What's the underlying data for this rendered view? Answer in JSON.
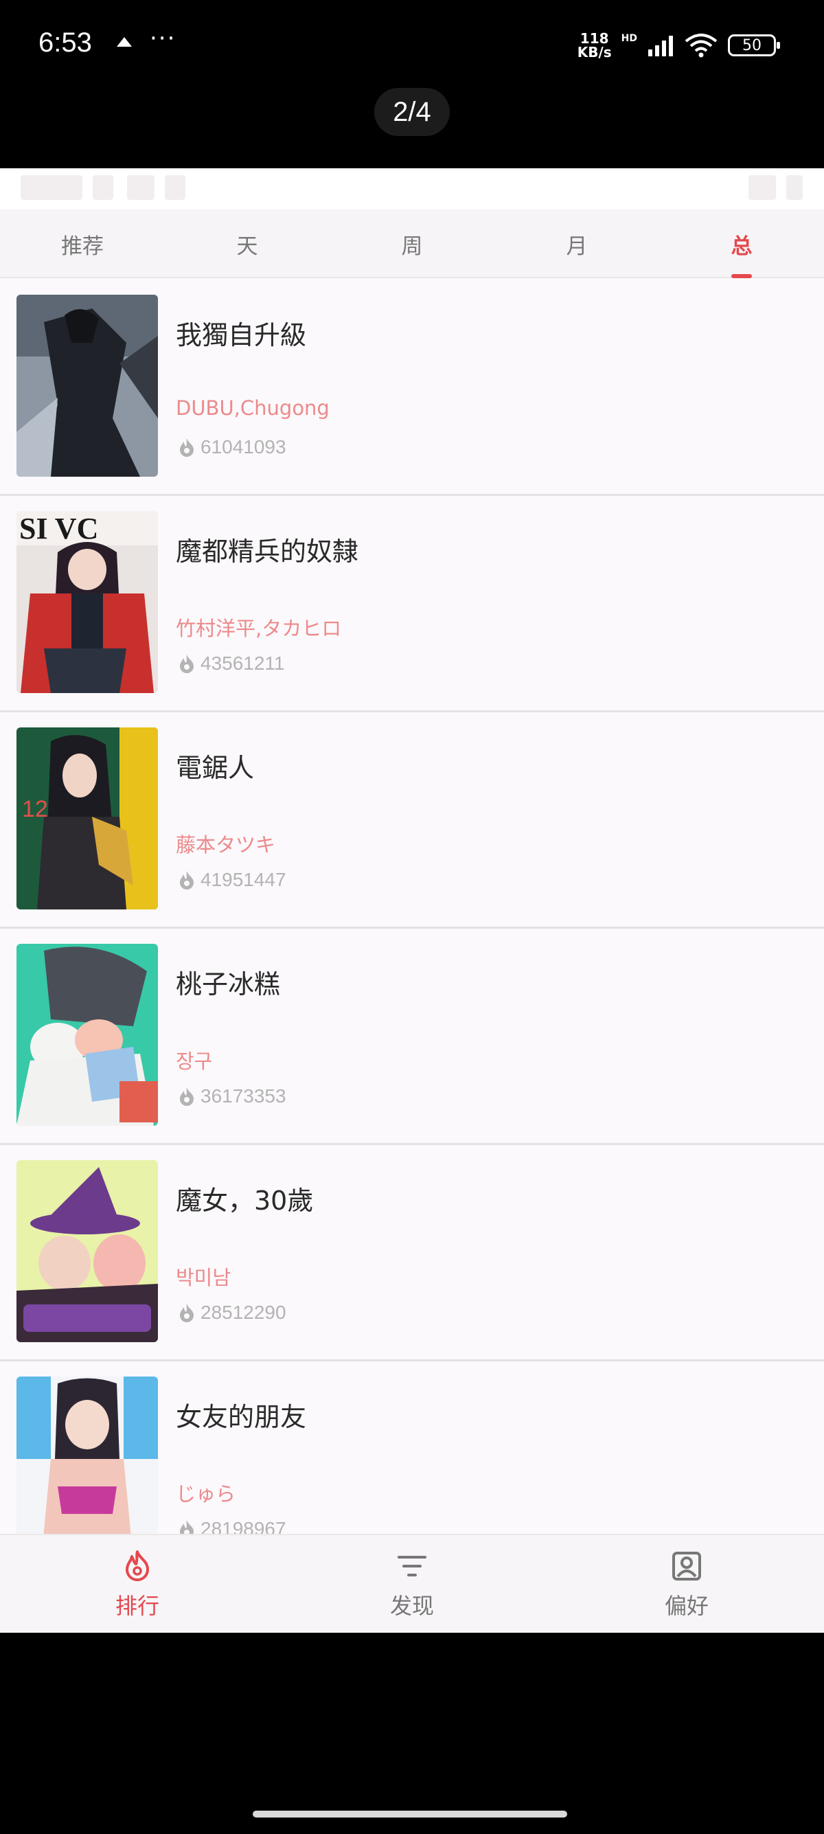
{
  "status_bar": {
    "time": "6:53",
    "dots": "···",
    "speed_value": "118",
    "speed_unit": "KB/s",
    "network_label": "HD",
    "battery": "50"
  },
  "page_indicator": "2/4",
  "tabs": [
    {
      "label": "推荐",
      "active": false
    },
    {
      "label": "天",
      "active": false
    },
    {
      "label": "周",
      "active": false
    },
    {
      "label": "月",
      "active": false
    },
    {
      "label": "总",
      "active": true
    }
  ],
  "items": [
    {
      "title": "我獨自升級",
      "author": "DUBU,Chugong",
      "views": "61041093"
    },
    {
      "title": "魔都精兵的奴隸",
      "author": "竹村洋平,タカヒロ",
      "views": "43561211"
    },
    {
      "title": "電鋸人",
      "author": "藤本タツキ",
      "views": "41951447"
    },
    {
      "title": "桃子冰糕",
      "author": "장구",
      "views": "36173353"
    },
    {
      "title": "魔女，30歲",
      "author": "박미남",
      "views": "28512290"
    },
    {
      "title": "女友的朋友",
      "author": "じゅら",
      "views": "28198967"
    }
  ],
  "bottom_nav": [
    {
      "label": "排行",
      "icon": "flame-icon",
      "active": true
    },
    {
      "label": "发现",
      "icon": "filter-icon",
      "active": false
    },
    {
      "label": "偏好",
      "icon": "profile-icon",
      "active": false
    }
  ],
  "colors": {
    "accent": "#e5484d",
    "author": "#ec8a8c",
    "muted": "#b3b3b3"
  }
}
